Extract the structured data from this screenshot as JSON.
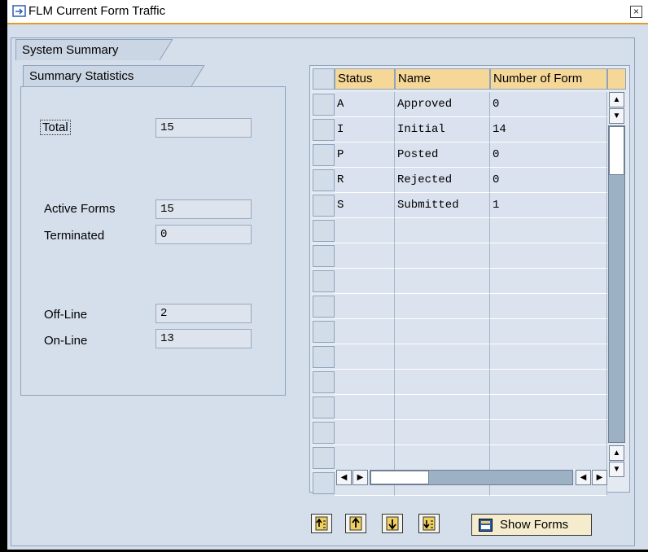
{
  "window": {
    "title": "FLM Current Form Traffic",
    "close_glyph": "×"
  },
  "tabs": {
    "system_summary": "System Summary",
    "summary_statistics": "Summary Statistics"
  },
  "stats": {
    "total_label": "Total",
    "total_value": "15",
    "active_label": "Active Forms",
    "active_value": "15",
    "terminated_label": "Terminated",
    "terminated_value": "0",
    "offline_label": "Off-Line",
    "offline_value": "2",
    "online_label": "On-Line",
    "online_value": "13"
  },
  "table": {
    "columns": [
      "Status",
      "Name",
      "Number of Form"
    ],
    "rows": [
      [
        "A",
        "Approved",
        "0"
      ],
      [
        "I",
        "Initial",
        "14"
      ],
      [
        "P",
        "Posted",
        "0"
      ],
      [
        "R",
        "Rejected",
        "0"
      ],
      [
        "S",
        "Submitted",
        "1"
      ]
    ],
    "empty_rows": 11
  },
  "scroll": {
    "up": "▲",
    "down": "▼",
    "left": "◀",
    "right": "▶"
  },
  "toolbar": {
    "show_forms_label": "Show Forms"
  },
  "colors": {
    "accent": "#e39b2c",
    "window_bg": "#d5deeb",
    "header_bg": "#f5d898"
  }
}
